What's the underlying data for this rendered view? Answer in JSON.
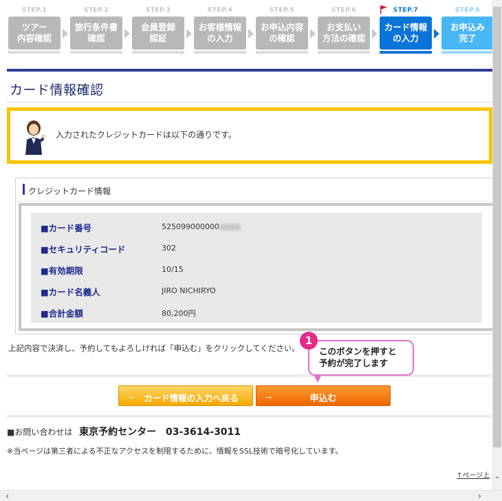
{
  "steps": [
    {
      "num": "STEP.1",
      "line1": "ツアー",
      "line2": "内容確認"
    },
    {
      "num": "STEP.2",
      "line1": "旅行条件書",
      "line2": "確認"
    },
    {
      "num": "STEP.3",
      "line1": "会員登録",
      "line2": "認証"
    },
    {
      "num": "STEP.4",
      "line1": "お客様情報",
      "line2": "の入力"
    },
    {
      "num": "STEP.5",
      "line1": "お申込内容",
      "line2": "の確認"
    },
    {
      "num": "STEP.6",
      "line1": "お支払い",
      "line2": "方法の確認"
    },
    {
      "num": "STEP.7",
      "line1": "カード情報",
      "line2": "の入力"
    },
    {
      "num": "STEP.8",
      "line1": "お申込み",
      "line2": "完了"
    }
  ],
  "page_title": "カード情報確認",
  "notice_text": "入力されたクレジットカードは以下の通りです。",
  "card_section_title": "クレジットカード情報",
  "card_rows": [
    {
      "label": "■カード番号",
      "value": "525099000000"
    },
    {
      "label": "■セキュリティコード",
      "value": "302"
    },
    {
      "label": "■有効期限",
      "value": "10/15"
    },
    {
      "label": "■カード名義人",
      "value": "JIRO NICHIRYO"
    },
    {
      "label": "■合計金額",
      "value": "80,200円"
    }
  ],
  "confirm_text": "上記内容で決済し、予約してもよろしければ「申込む」をクリックしてください。",
  "buttons": {
    "back_label": "カード情報の入力へ戻る",
    "apply_label": "申込む",
    "arrow": "→"
  },
  "callout": {
    "badge": "1",
    "line1": "このボタンを押すと",
    "line2": "予約が完了します"
  },
  "contact": {
    "prefix": "■お問い合わせは",
    "center": "東京予約センター",
    "tel": "03-3614-3011"
  },
  "note": "※当ページは第三者による不正なアクセスを制限するために、情報をSSL技術で暗号化しています。",
  "page_top": "↑ページ上",
  "colors": {
    "active_step": "#0b74d8",
    "future_step": "#49b6f5",
    "done_step": "#b8b8b8",
    "notice_border": "#f7c400",
    "apply_button": "#f06800",
    "back_button": "#f5a800",
    "callout_border": "#e070c8",
    "badge": "#e52a8a"
  }
}
